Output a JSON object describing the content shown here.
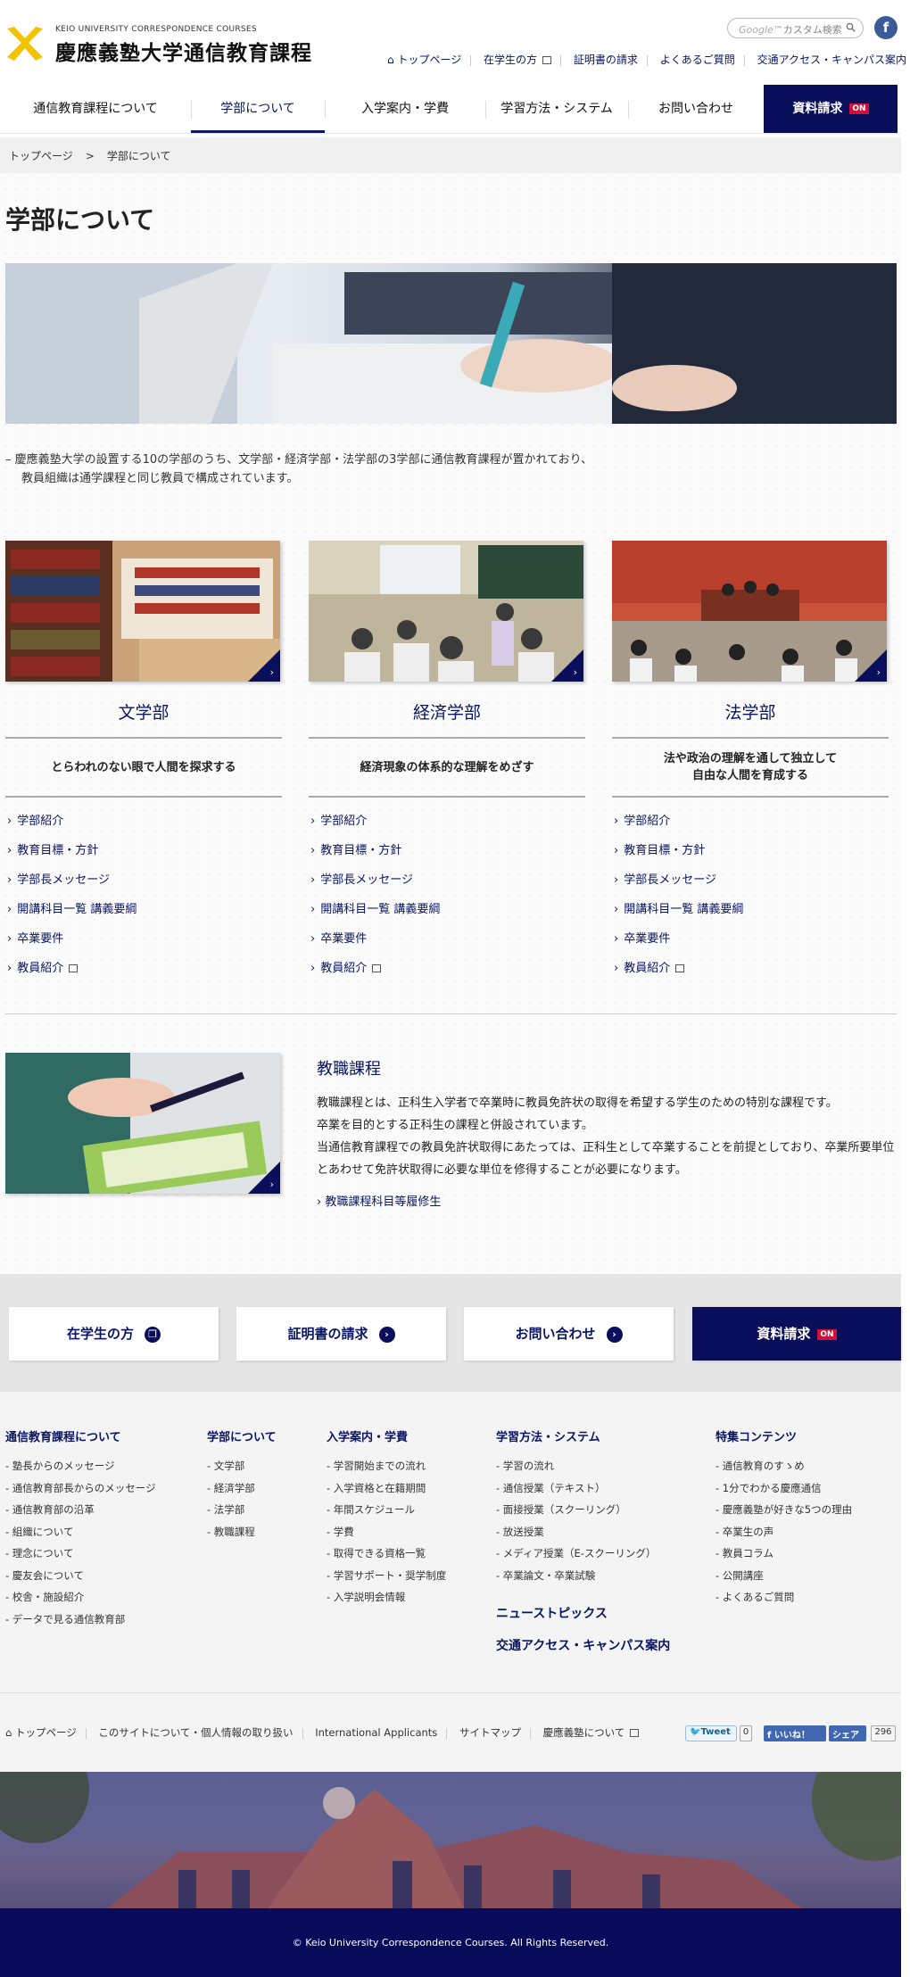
{
  "header": {
    "logo_en": "KEIO UNIVERSITY CORRESPONDENCE COURSES",
    "logo_ja": "慶應義塾大学通信教育課程",
    "search_brand": "Google™",
    "search_placeholder": "カスタム検索",
    "facebook": "f",
    "util": [
      "トップページ",
      "在学生の方",
      "証明書の請求",
      "よくあるご質問",
      "交通アクセス・キャンパス案内"
    ]
  },
  "gnav": {
    "items": [
      "通信教育課程について",
      "学部について",
      "入学案内・学費",
      "学習方法・システム",
      "お問い合わせ"
    ],
    "active": "学部について",
    "request": "資料請求",
    "on": "ON"
  },
  "breadcrumb": {
    "home": "トップページ",
    "sep": ">",
    "current": "学部について"
  },
  "page": {
    "title": "学部について",
    "intro_line1": "– 慶應義塾大学の設置する10の学部のうち、文学部・経済学部・法学部の3学部に通信教育課程が置かれており、",
    "intro_line2": "教員組織は通学課程と同じ教員で構成されています。"
  },
  "faculties": [
    {
      "name": "文学部",
      "catch": "とらわれのない眼で人間を探求する",
      "links": [
        "学部紹介",
        "教育目標・方針",
        "学部長メッセージ",
        "開講科目一覧 講義要綱",
        "卒業要件",
        "教員紹介"
      ]
    },
    {
      "name": "経済学部",
      "catch": "経済現象の体系的な理解をめざす",
      "links": [
        "学部紹介",
        "教育目標・方針",
        "学部長メッセージ",
        "開講科目一覧 講義要綱",
        "卒業要件",
        "教員紹介"
      ]
    },
    {
      "name": "法学部",
      "catch": "法や政治の理解を通して独立して\n自由な人間を育成する",
      "links": [
        "学部紹介",
        "教育目標・方針",
        "学部長メッセージ",
        "開講科目一覧 講義要綱",
        "卒業要件",
        "教員紹介"
      ]
    }
  ],
  "kyoshoku": {
    "title": "教職課程",
    "p1": "教職課程とは、正科生入学者で卒業時に教員免許状の取得を希望する学生のための特別な課程です。",
    "p2": "卒業を目的とする正科生の課程と併設されています。",
    "p3": "当通信教育課程での教員免許状取得にあたっては、正科生として卒業することを前提としており、卒業所要単位とあわせて免許状取得に必要な単位を修得することが必要になります。",
    "link": "教職課程科目等履修生"
  },
  "bottom_buttons": [
    "在学生の方",
    "証明書の請求",
    "お問い合わせ",
    "資料請求"
  ],
  "footer": {
    "cols": [
      {
        "title": "通信教育課程について",
        "items": [
          "- 塾長からのメッセージ",
          "- 通信教育部長からのメッセージ",
          "- 通信教育部の沿革",
          "- 組織について",
          "- 理念について",
          "- 慶友会について",
          "- 校舎・施設紹介",
          "- データで見る通信教育部"
        ]
      },
      {
        "title": "学部について",
        "items": [
          "- 文学部",
          "- 経済学部",
          "- 法学部",
          "- 教職課程"
        ]
      },
      {
        "title": "入学案内・学費",
        "items": [
          "- 学習開始までの流れ",
          "- 入学資格と在籍期間",
          "- 年間スケジュール",
          "- 学費",
          "- 取得できる資格一覧",
          "- 学習サポート・奨学制度",
          "- 入学説明会情報"
        ]
      },
      {
        "title": "学習方法・システム",
        "items": [
          "- 学習の流れ",
          "- 通信授業（テキスト）",
          "- 面接授業（スクーリング）",
          "- 放送授業",
          "- メディア授業（E-スクーリング）",
          "- 卒業論文・卒業試験"
        ]
      },
      {
        "title": "特集コンテンツ",
        "items": [
          "- 通信教育のすゝめ",
          "- 1分でわかる慶應通信",
          "- 慶應義塾が好きな5つの理由",
          "- 卒業生の声",
          "- 教員コラム",
          "- 公開講座",
          "- よくあるご質問"
        ]
      }
    ],
    "news": "ニューストピックス",
    "access": "交通アクセス・キャンパス案内",
    "links": [
      "トップページ",
      "このサイトについて・個人情報の取り扱い",
      "International Applicants",
      "サイトマップ",
      "慶應義塾について"
    ],
    "tweet": "Tweet",
    "tweet_count": "0",
    "like": "いいね！",
    "share": "シェア",
    "like_count": "296",
    "copyright": "© Keio University Correspondence Courses. All Rights Reserved."
  }
}
